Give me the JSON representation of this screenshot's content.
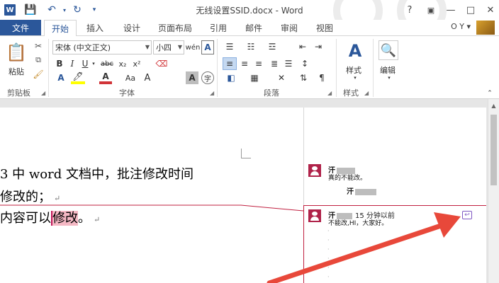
{
  "window": {
    "title": "无线设置SSID.docx - Word",
    "help": "?",
    "controls": [
      "—",
      "□",
      "✕"
    ]
  },
  "quick_access": [
    "save-icon",
    "undo-icon",
    "redo-icon"
  ],
  "tabs": {
    "file": "文件",
    "items": [
      "开始",
      "插入",
      "设计",
      "页面布局",
      "引用",
      "邮件",
      "审阅",
      "视图"
    ],
    "active": "开始"
  },
  "user": {
    "name": "O Y ▾"
  },
  "ribbon": {
    "clipboard": {
      "label": "剪贴板",
      "paste": "粘贴"
    },
    "font": {
      "label": "字体",
      "font_name": "宋体 (中文正文)",
      "font_size": "小四",
      "font_size_btn": "A",
      "change_case": "Aa"
    },
    "paragraph": {
      "label": "段落"
    },
    "styles": {
      "label": "样式",
      "button": "样式"
    },
    "editing": {
      "button": "编辑"
    }
  },
  "document": {
    "lines": [
      "3 中 word 文档中，批注修改时间",
      "修改的；",
      "内容可以"
    ],
    "highlight": "修改",
    "tail": "。"
  },
  "comments": [
    {
      "name": "汗",
      "time": "",
      "text": "真的不能改。"
    },
    {
      "name": "汗",
      "time": "",
      "text": ""
    },
    {
      "name": "汗",
      "time": "15 分钟以前",
      "text": "不能改,HI，大家好。"
    }
  ],
  "colors": {
    "accent": "#2b579a",
    "comment": "#c02040",
    "arrow": "#e8483a"
  }
}
